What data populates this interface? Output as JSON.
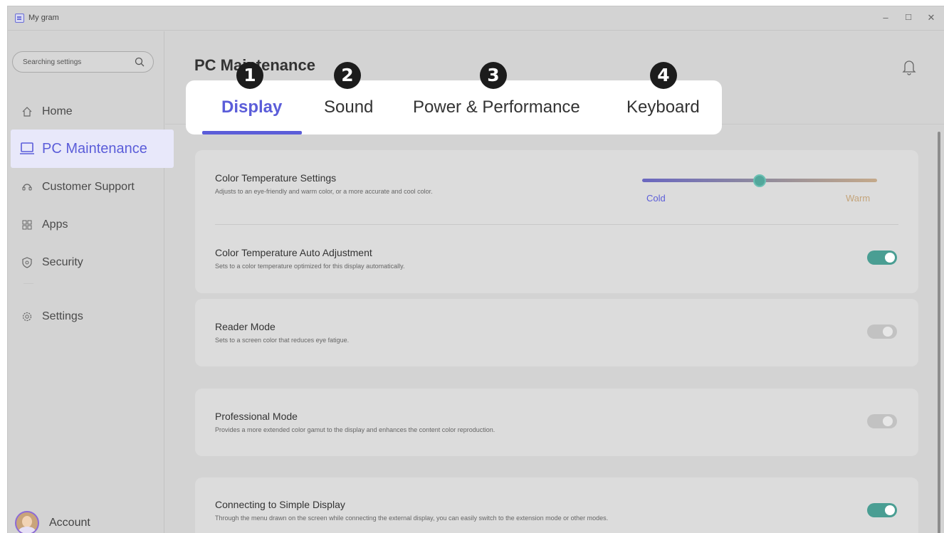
{
  "window": {
    "title": "My gram",
    "controls": {
      "minimize": "–",
      "maximize": "☐",
      "close": "✕"
    }
  },
  "sidebar": {
    "search_placeholder": "Searching settings",
    "items": [
      {
        "label": "Home",
        "icon": "home-icon"
      },
      {
        "label": "PC Maintenance",
        "icon": "laptop-icon",
        "active": true
      },
      {
        "label": "Customer Support",
        "icon": "support-icon"
      },
      {
        "label": "Apps",
        "icon": "apps-grid-icon"
      },
      {
        "label": "Security",
        "icon": "shield-icon"
      },
      {
        "label": "Settings",
        "icon": "gear-icon"
      }
    ],
    "account_label": "Account"
  },
  "header": {
    "title": "PC Maintenance"
  },
  "tabs": [
    {
      "label": "Display",
      "active": true,
      "badge": "1"
    },
    {
      "label": "Sound",
      "badge": "2"
    },
    {
      "label": "Power & Performance",
      "badge": "3"
    },
    {
      "label": "Keyboard",
      "badge": "4"
    }
  ],
  "settings": {
    "color_temperature": {
      "title": "Color Temperature Settings",
      "description": "Adjusts to an eye-friendly and warm color, or a more accurate and cool color.",
      "min_label": "Cold",
      "max_label": "Warm",
      "value_fraction": 0.5
    },
    "auto_adjust": {
      "title": "Color Temperature Auto Adjustment",
      "description": "Sets to a color temperature optimized for this display automatically.",
      "on": true
    },
    "reader_mode": {
      "title": "Reader Mode",
      "description": "Sets to a screen color that reduces eye fatigue.",
      "on": false
    },
    "professional_mode": {
      "title": "Professional Mode",
      "description": "Provides a more extended color gamut to the display and enhances the content color reproduction.",
      "on": false
    },
    "simple_display": {
      "title": "Connecting to Simple Display",
      "description": "Through the menu drawn on the screen while connecting the external display, you can easily switch to the extension mode or other modes.",
      "on": true
    }
  },
  "colors": {
    "accent": "#5b5dd9",
    "toggle_on": "#4a9e93",
    "toggle_off": "#c2c2c2"
  }
}
